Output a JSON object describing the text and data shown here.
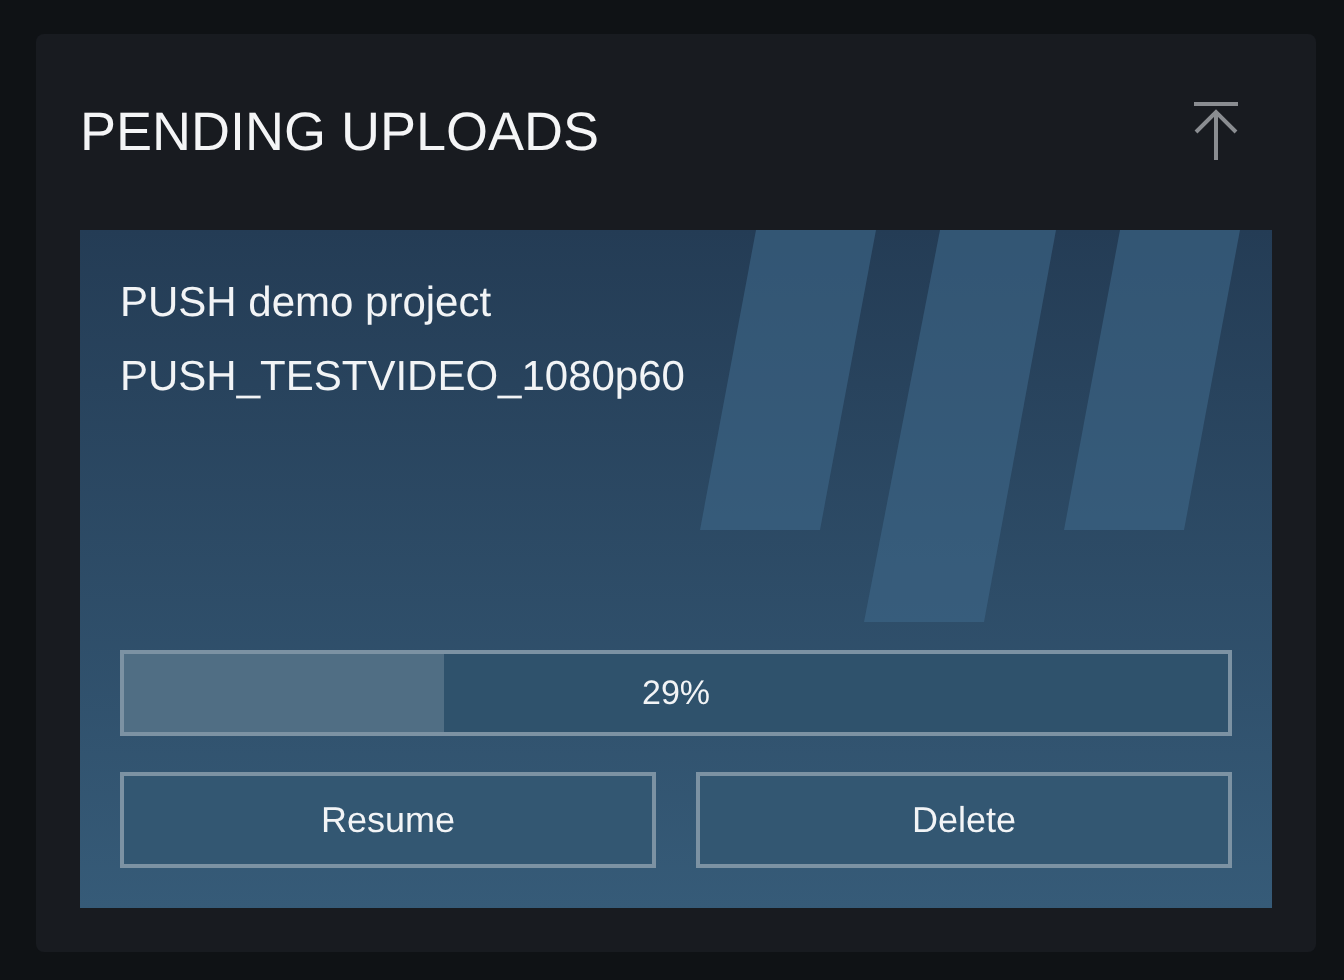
{
  "panel": {
    "title": "PENDING UPLOADS"
  },
  "uploads": [
    {
      "project": "PUSH demo project",
      "file": "PUSH_TESTVIDEO_1080p60",
      "level": 0.29,
      "reading": "29%",
      "buttons": [
        "Resume",
        "Delete"
      ]
    }
  ]
}
